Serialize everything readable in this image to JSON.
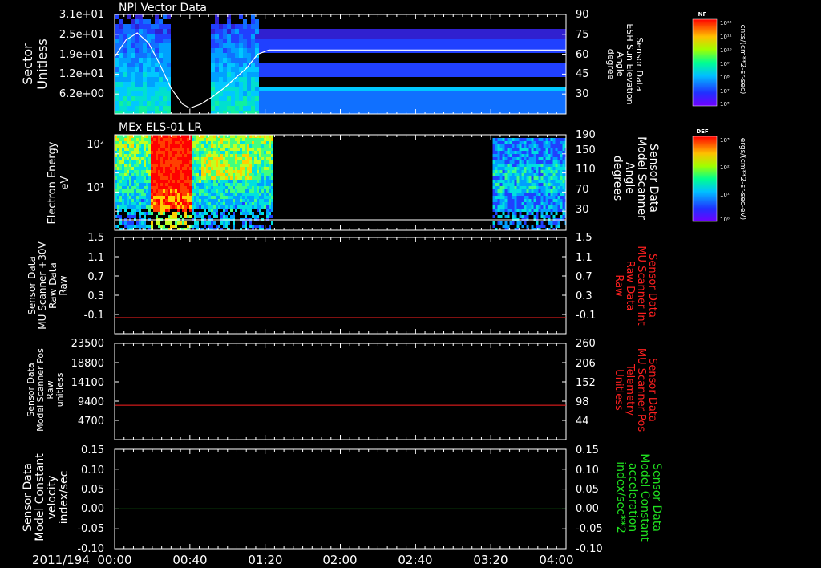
{
  "figure": {
    "date_label": "2011/194",
    "time_ticks": [
      "00:00",
      "00:40",
      "01:20",
      "02:00",
      "02:40",
      "03:20",
      "04:00"
    ]
  },
  "chart_data": [
    {
      "id": "npi",
      "type": "heatmap",
      "title": "NPI Vector Data",
      "ylabel_left": [
        "Sector",
        "Unitless"
      ],
      "yticks_left": [
        "3.1e+01",
        "2.5e+01",
        "1.9e+01",
        "1.2e+01",
        "6.2e+00"
      ],
      "ylabel_right": [
        "Sensor Data",
        "ESH Sun Elevation",
        "Angle",
        "degree"
      ],
      "yticks_right": [
        "90",
        "75",
        "60",
        "45",
        "30"
      ],
      "colorbar": {
        "label": "NF",
        "units": "cnts/(cm**2-sr-sec)",
        "ticks": [
          "10¹²",
          "10¹¹",
          "10¹⁰",
          "10⁹",
          "10⁸",
          "10⁷",
          "10⁶"
        ]
      },
      "overlay_line": {
        "color": "#ffffff",
        "x_minutes": [
          0,
          6,
          12,
          18,
          24,
          30,
          36,
          40,
          46,
          52,
          58,
          64,
          70,
          76,
          82,
          240
        ],
        "y_degrees": [
          60,
          72,
          77,
          70,
          55,
          38,
          27,
          24,
          27,
          32,
          38,
          45,
          52,
          62,
          65,
          65
        ]
      }
    },
    {
      "id": "els",
      "type": "heatmap",
      "title": "MEx ELS-01 LR",
      "ylabel_left": [
        "Electron Energy",
        "eV"
      ],
      "yticks_left": [
        "10²",
        "10¹"
      ],
      "ylabel_right": [
        "Sensor Data",
        "Model Scanner",
        "Angle",
        "degrees"
      ],
      "yticks_right": [
        "190",
        "150",
        "110",
        "70",
        "30"
      ],
      "colorbar": {
        "label": "DEF",
        "units": "ergs/(cm**2-sr-sec-eV)",
        "ticks": [
          "10³",
          "10²",
          "10¹",
          "10⁰"
        ]
      },
      "overlay_line": {
        "color": "#ffffff",
        "y_degrees": 20
      }
    },
    {
      "id": "mu-raw",
      "type": "line",
      "ylabel_left": [
        "Sensor Data",
        "MU Scanner +30V",
        "Raw Data",
        "Raw"
      ],
      "yticks_left": [
        "1.5",
        "1.1",
        "0.7",
        "0.3",
        "-0.1"
      ],
      "ylabel_right": [
        "Sensor Data",
        "MU Scanner Int",
        "Raw Data",
        "Raw"
      ],
      "yticks_right": [
        "1.5",
        "1.1",
        "0.7",
        "0.3",
        "-0.1"
      ],
      "ylim": [
        -0.3,
        1.5
      ],
      "series": [
        {
          "color": "#ff2020",
          "value": 0.0
        }
      ],
      "right_label_color": "#ff2020"
    },
    {
      "id": "scanner-pos",
      "type": "line",
      "ylabel_left": [
        "Sensor Data",
        "Model Scanner Pos",
        "Raw",
        "unitless"
      ],
      "yticks_left": [
        "23500",
        "18800",
        "14100",
        "9400",
        "4700"
      ],
      "ylabel_right": [
        "Sensor Data",
        "MU Scanner Pos",
        "Telemetry",
        "Unitless"
      ],
      "yticks_right": [
        "260",
        "206",
        "152",
        "98",
        "44"
      ],
      "ylim": [
        0,
        23500
      ],
      "series": [
        {
          "color": "#ff2020",
          "value": 8400
        }
      ],
      "right_label_color": "#ff2020"
    },
    {
      "id": "constant",
      "type": "line",
      "ylabel_left": [
        "Sensor Data",
        "Model Constant",
        "velocity",
        "index/sec"
      ],
      "yticks_left": [
        "0.15",
        "0.10",
        "0.05",
        "0.00",
        "-0.05",
        "-0.10"
      ],
      "ylabel_right": [
        "Sensor Data",
        "Model Constant",
        "acceleration",
        "index/sec**2"
      ],
      "yticks_right": [
        "0.15",
        "0.10",
        "0.05",
        "0.00",
        "-0.05",
        "-0.10"
      ],
      "ylim": [
        -0.1,
        0.15
      ],
      "series": [
        {
          "color": "#20e020",
          "value": 0.0
        }
      ],
      "right_label_color": "#20e020"
    }
  ]
}
